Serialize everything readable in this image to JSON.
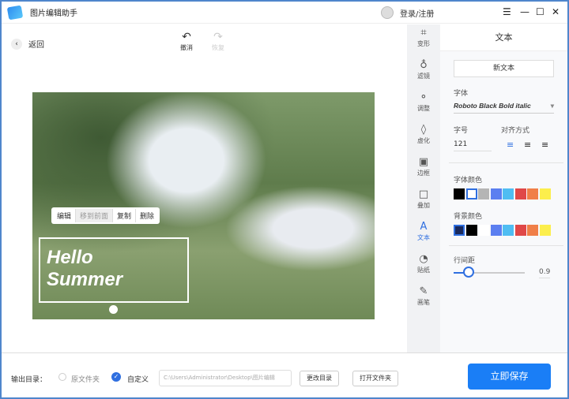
{
  "app": {
    "title": "图片编辑助手",
    "login": "登录/注册"
  },
  "toolbar": {
    "back": "返回",
    "undo": "撤消",
    "redo": "恢复"
  },
  "canvas": {
    "context_menu": [
      "编辑",
      "移到前面",
      "复制",
      "删除"
    ],
    "text_line1": "Hello",
    "text_line2": "Summer"
  },
  "tools": [
    {
      "label": "变形",
      "icon": "crop-icon"
    },
    {
      "label": "滤镜",
      "icon": "flask-icon"
    },
    {
      "label": "调整",
      "icon": "adjust-icon"
    },
    {
      "label": "虚化",
      "icon": "drop-icon"
    },
    {
      "label": "边框",
      "icon": "frame-icon"
    },
    {
      "label": "叠加",
      "icon": "overlay-icon"
    },
    {
      "label": "文本",
      "icon": "text-icon",
      "active": true
    },
    {
      "label": "贴纸",
      "icon": "sticker-icon"
    },
    {
      "label": "画笔",
      "icon": "brush-icon"
    }
  ],
  "panel": {
    "title": "文本",
    "new_text": "新文本",
    "font_label": "字体",
    "font_value": "Roboto Black Bold italic",
    "size_label": "字号",
    "size_value": "121",
    "align_label": "对齐方式",
    "font_color_label": "字体颜色",
    "font_colors": [
      "#000000",
      "#ffffff",
      "#b5b5b5",
      "#5b7ff0",
      "#4fbdf2",
      "#e04848",
      "#f07f48",
      "#fcee4c"
    ],
    "bg_color_label": "背景颜色",
    "bg_colors": [
      "#1a2a5c",
      "#000000",
      "#ffffff",
      "#5b7ff0",
      "#4fbdf2",
      "#e04848",
      "#f07f48",
      "#fcee4c"
    ],
    "line_spacing_label": "行间距",
    "line_spacing_value": "0.9"
  },
  "bottom": {
    "output_label": "输出目录：",
    "opt_original": "原文件夹",
    "opt_custom": "自定义",
    "path": "C:\\Users\\Administrator\\Desktop\\图片编辑",
    "change_dir": "更改目录",
    "open_folder": "打开文件夹",
    "save": "立即保存"
  },
  "colors": {
    "accent": "#1a7ef6"
  }
}
